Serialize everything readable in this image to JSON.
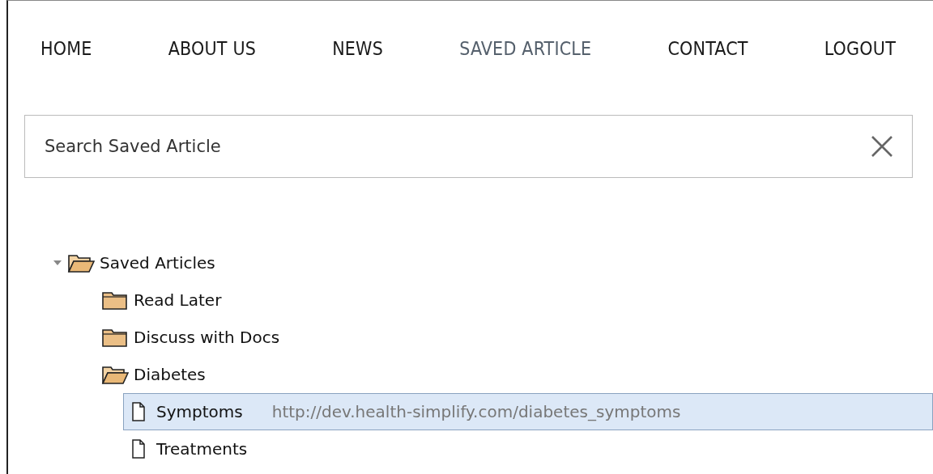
{
  "nav": [
    {
      "label": "HOME",
      "selected": false
    },
    {
      "label": "ABOUT US",
      "selected": false
    },
    {
      "label": "NEWS",
      "selected": false
    },
    {
      "label": "SAVED ARTICLE",
      "selected": true
    },
    {
      "label": "CONTACT",
      "selected": false
    },
    {
      "label": "LOGOUT",
      "selected": false
    }
  ],
  "search": {
    "placeholder": "Search Saved Article"
  },
  "tree": [
    {
      "kind": "folder",
      "label": "Saved Articles",
      "expanded": true,
      "selected": false,
      "children": [
        {
          "kind": "folder",
          "label": "Read Later",
          "expanded": false,
          "selected": false
        },
        {
          "kind": "folder",
          "label": "Discuss with Docs",
          "expanded": false,
          "selected": false
        },
        {
          "kind": "folder",
          "label": "Diabetes",
          "expanded": true,
          "selected": false,
          "children": [
            {
              "kind": "file",
              "label": "Symptoms",
              "url": "http://dev.health-simplify.com/diabetes_symptoms",
              "selected": true
            },
            {
              "kind": "file",
              "label": "Treatments",
              "selected": false
            }
          ]
        }
      ]
    }
  ]
}
